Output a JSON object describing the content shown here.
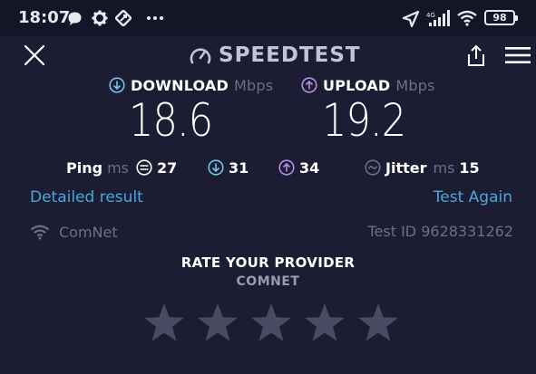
{
  "status_bar": {
    "time": "18:07",
    "battery": "98",
    "icons": [
      "chat-icon",
      "gear-icon",
      "app-icon",
      "more-icon",
      "location-icon",
      "signal-icon",
      "wifi-icon",
      "battery-icon"
    ]
  },
  "header": {
    "title": "SPEEDTEST",
    "close_icon": "close-icon",
    "share_icon": "share-icon",
    "menu_icon": "menu-icon",
    "logo_icon": "gauge-icon"
  },
  "download": {
    "label": "DOWNLOAD",
    "unit": "Mbps",
    "value": "18.6",
    "icon": "arrow-down-circle-icon"
  },
  "upload": {
    "label": "UPLOAD",
    "unit": "Mbps",
    "value": "19.2",
    "icon": "arrow-up-circle-icon"
  },
  "ping": {
    "label": "Ping",
    "unit": "ms",
    "idle": "27",
    "download": "31",
    "upload": "34"
  },
  "jitter": {
    "label": "Jitter",
    "unit": "ms",
    "value": "15"
  },
  "links": {
    "detailed": "Detailed result",
    "again": "Test Again"
  },
  "connection": {
    "provider": "ComNet",
    "test_id": "Test ID 9628331262"
  },
  "rating": {
    "title": "RATE YOUR PROVIDER",
    "provider": "COMNET",
    "stars_total": 5,
    "stars_selected": 0
  },
  "colors": {
    "background": "#1c1d33",
    "status_bar": "#141526",
    "link": "#4aa7da",
    "download_accent": "#6ec6e8",
    "upload_accent": "#b58ee8",
    "muted": "#6d6f88",
    "star": "#4a4b63"
  }
}
